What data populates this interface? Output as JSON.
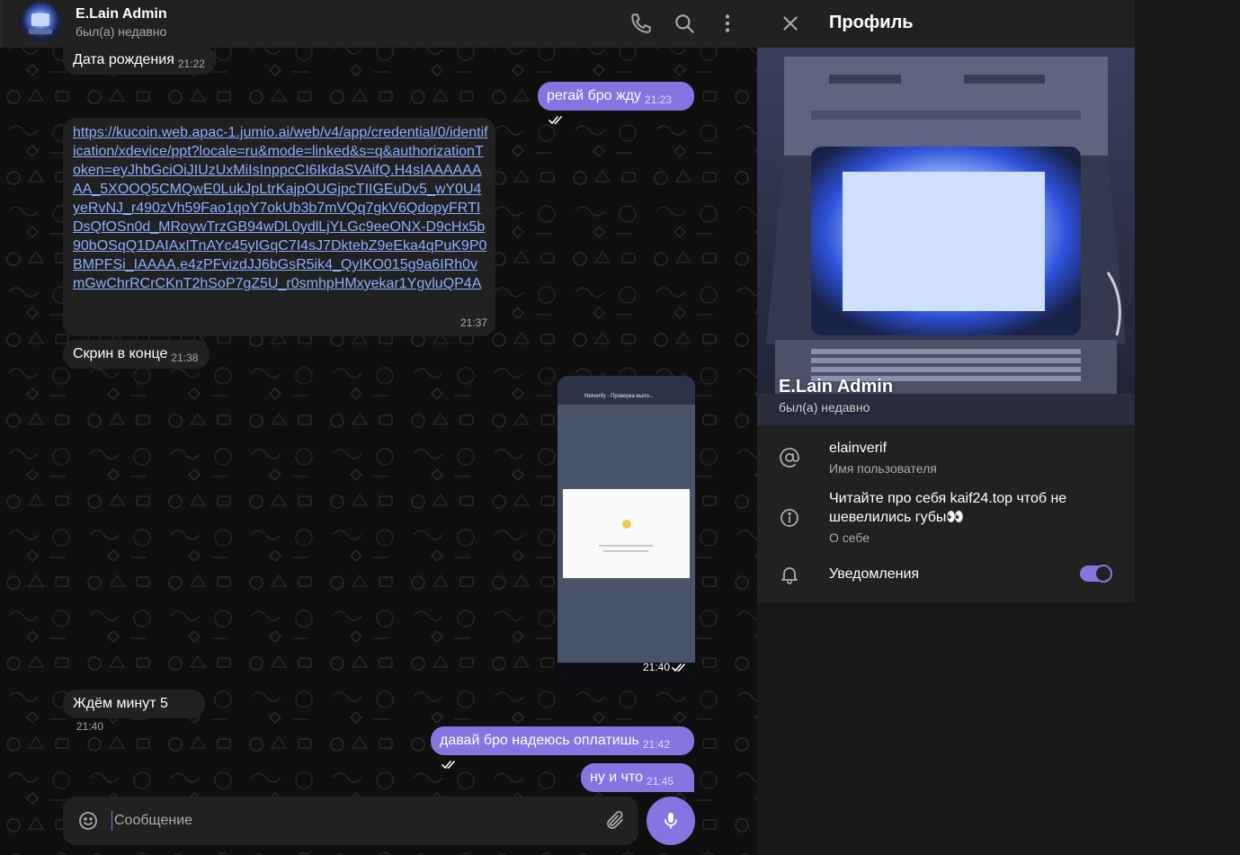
{
  "chat_header": {
    "title": "E.Lain Admin",
    "status": "был(а) недавно",
    "icons": [
      "phone-icon",
      "search-icon",
      "more-vertical-icon"
    ]
  },
  "messages": [
    {
      "direction": "in",
      "text": "Дата рождения",
      "time": "21:22"
    },
    {
      "direction": "out",
      "text": "регай бро жду",
      "time": "21:23",
      "status": "read"
    },
    {
      "direction": "in",
      "text": "https://kucoin.web.apac-1.jumio.ai/web/v4/app/credential/0/identification/xdevice/ppt?locale=ru&mode=linked&s=q&authorizationToken=eyJhbGciOiJIUzUxMiIsInppcCI6IkdaSVAifQ.H4sIAAAAAAAA_5XOOQ5CMQwE0LukJpLtrKajpOUGjpcTIIGEuDv5_wY0U4yeRvNJ_r490zVh59Fao1qoY7okUb3b7mVQq7gkV6QdopyFRTIDsQfOSn0d_MRoywTrzGB94wDL0ydlLjYLGc9eeONX-D9cHx5b90bOSqQ1DAIAxITnAYc45yIGqC7I4sJ7DktebZ9eEka4qPuK9P0BMPFSi_IAAAA.e4zPFvizdJJ6bGsR5ik4_QyIKO015g9a6IRh0vmGwChrRCrCKnT2hSoP7gZ5U_r0smhpHMxyekar1YgvluQP4A",
      "time": "21:37"
    },
    {
      "direction": "in",
      "text": "Скрин в конце",
      "time": "21:38"
    },
    {
      "direction": "out",
      "type": "photo",
      "photo_caption": "Netverify - Проверка выло...",
      "photo_sub": "kucoin.web.apac-1.jumio.ai",
      "photo_text": "Проверка своей рабочей стоки",
      "time": "21:40",
      "status": "read"
    },
    {
      "direction": "in",
      "text": "Ждём минут 5",
      "time": "21:40"
    },
    {
      "direction": "out",
      "text": "давай бро надеюсь оплатишь",
      "time": "21:42",
      "status": "read"
    },
    {
      "direction": "out",
      "text": "ну и что",
      "time": "21:45",
      "status": "sent"
    }
  ],
  "composer": {
    "placeholder": "Сообщение"
  },
  "profile": {
    "header_title": "Профиль",
    "name": "E.Lain Admin",
    "last_seen": "был(а) недавно",
    "username": "elainverif",
    "username_label": "Имя пользователя",
    "about": "Читайте про себя kaif24.top чтоб не шевелились губы👀",
    "about_label": "О себе",
    "notifications_label": "Уведомления",
    "notifications_enabled": true
  },
  "colors": {
    "accent": "#8774e1",
    "link": "#8caeff",
    "panel": "#212121",
    "background": "#0f0f0f"
  }
}
